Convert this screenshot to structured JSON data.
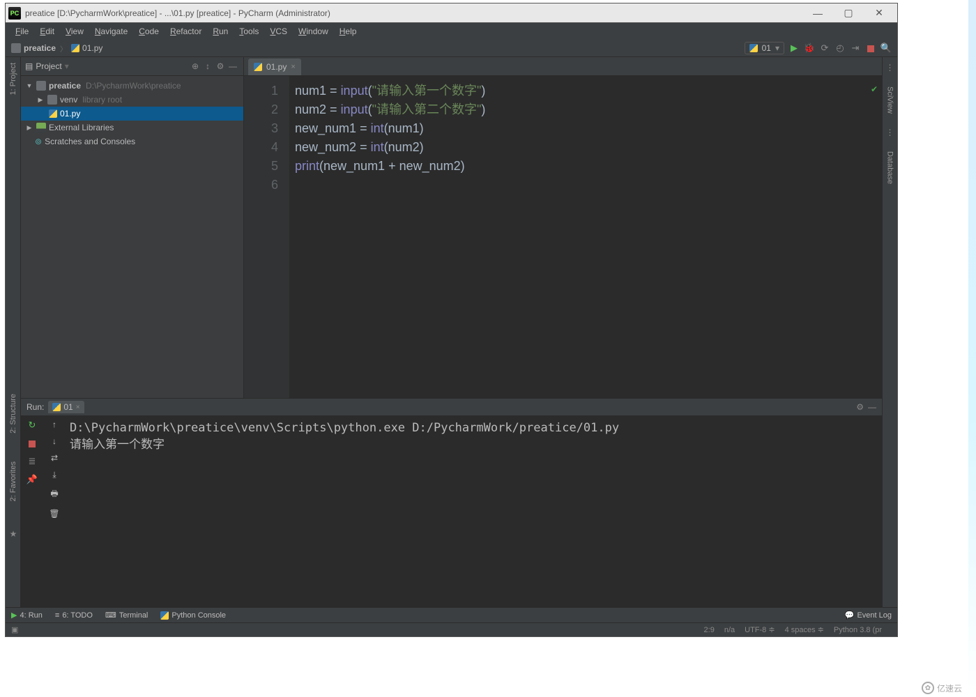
{
  "title": "preatice [D:\\PycharmWork\\preatice] - ...\\01.py [preatice] - PyCharm (Administrator)",
  "menus": [
    "File",
    "Edit",
    "View",
    "Navigate",
    "Code",
    "Refactor",
    "Run",
    "Tools",
    "VCS",
    "Window",
    "Help"
  ],
  "breadcrumb": {
    "root": "preatice",
    "file": "01.py"
  },
  "run_config": {
    "name": "01"
  },
  "project_panel": {
    "title": "Project",
    "root": {
      "name": "preatice",
      "path": "D:\\PycharmWork\\preatice"
    },
    "venv": {
      "name": "venv",
      "hint": "library root"
    },
    "file": "01.py",
    "ext": "External Libraries",
    "scratch": "Scratches and Consoles"
  },
  "editor": {
    "tab": "01.py",
    "lines": [
      [
        {
          "t": "num1 ",
          "c": "kw-var"
        },
        {
          "t": "=",
          "c": "kw-op"
        },
        {
          "t": " ",
          "c": ""
        },
        {
          "t": "input",
          "c": "kw-func"
        },
        {
          "t": "(",
          "c": ""
        },
        {
          "t": "\"请输入第一个数字\"",
          "c": "kw-str"
        },
        {
          "t": ")",
          "c": ""
        }
      ],
      [
        {
          "t": "num2 ",
          "c": "kw-var"
        },
        {
          "t": "=",
          "c": "kw-op"
        },
        {
          "t": " ",
          "c": ""
        },
        {
          "t": "input",
          "c": "kw-func"
        },
        {
          "t": "(",
          "c": ""
        },
        {
          "t": "\"请输入第二个数字\"",
          "c": "kw-str"
        },
        {
          "t": ")",
          "c": ""
        }
      ],
      [
        {
          "t": "new_num1 ",
          "c": "kw-var"
        },
        {
          "t": "=",
          "c": "kw-op"
        },
        {
          "t": " ",
          "c": ""
        },
        {
          "t": "int",
          "c": "kw-func"
        },
        {
          "t": "(num1)",
          "c": ""
        }
      ],
      [
        {
          "t": "new_num2 ",
          "c": "kw-var"
        },
        {
          "t": "=",
          "c": "kw-op"
        },
        {
          "t": " ",
          "c": ""
        },
        {
          "t": "int",
          "c": "kw-func"
        },
        {
          "t": "(num2)",
          "c": ""
        }
      ],
      [
        {
          "t": "print",
          "c": "kw-func"
        },
        {
          "t": "(new_num1 ",
          "c": ""
        },
        {
          "t": "+",
          "c": "kw-op"
        },
        {
          "t": " new_num2)",
          "c": ""
        }
      ],
      []
    ]
  },
  "left_tools": [
    "1: Project"
  ],
  "left_tools2": [
    "2: Structure",
    "2: Favorites"
  ],
  "right_tools": [
    "SciView",
    "Database"
  ],
  "run": {
    "label": "Run:",
    "tab": "01",
    "console": "D:\\PycharmWork\\preatice\\venv\\Scripts\\python.exe D:/PycharmWork/preatice/01.py\n请输入第一个数字"
  },
  "bottom_tools": {
    "run": "4: Run",
    "todo": "6: TODO",
    "terminal": "Terminal",
    "pyconsole": "Python Console",
    "eventlog": "Event Log"
  },
  "status": {
    "pos": "2:9",
    "na": "n/a",
    "enc": "UTF-8",
    "indent": "4 spaces",
    "py": "Python 3.8 (pr"
  },
  "watermark": "亿速云"
}
